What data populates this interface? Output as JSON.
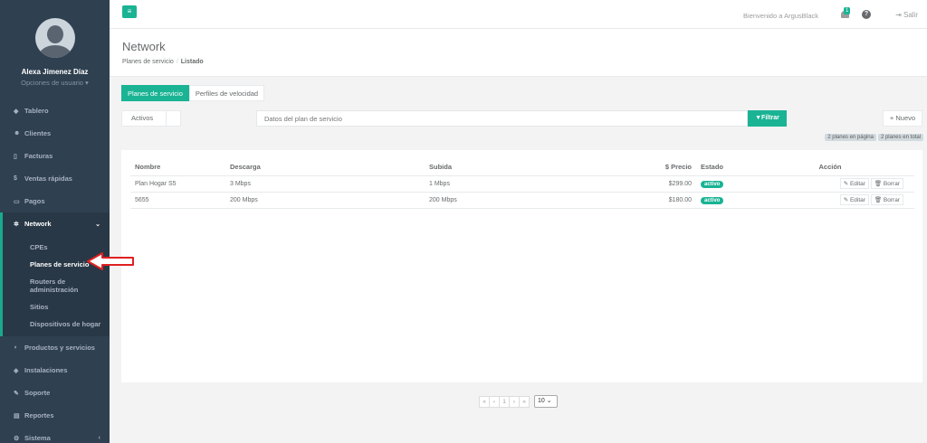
{
  "sidebar": {
    "profile": {
      "name": "Alexa Jimenez Díaz",
      "options": "Opciones de usuario ▾"
    },
    "items": [
      {
        "icon": "dashboard-icon",
        "glyph": "◆",
        "label": "Tablero"
      },
      {
        "icon": "users-icon",
        "glyph": "☻",
        "label": "Clientes"
      },
      {
        "icon": "document-icon",
        "glyph": "▯",
        "label": "Facturas"
      },
      {
        "icon": "dollar-icon",
        "glyph": "$",
        "label": "Ventas rápidas"
      },
      {
        "icon": "card-icon",
        "glyph": "▭",
        "label": "Pagos"
      },
      {
        "icon": "cog-icon",
        "glyph": "✲",
        "label": "Network",
        "chevron": "⌄"
      },
      {
        "icon": "tag-icon",
        "glyph": "◗",
        "label": "Productos y servicios"
      },
      {
        "icon": "wrench-icon",
        "glyph": "◈",
        "label": "Instalaciones"
      },
      {
        "icon": "support-icon",
        "glyph": "✎",
        "label": "Soporte"
      },
      {
        "icon": "book-icon",
        "glyph": "▤",
        "label": "Reportes"
      },
      {
        "icon": "gears-icon",
        "glyph": "⚙",
        "label": "Sistema",
        "chevron": "‹"
      }
    ],
    "network_sub": [
      "CPEs",
      "Planes de servicio",
      "Routers de administración",
      "Sitios",
      "Dispositivos de hogar"
    ]
  },
  "topbar": {
    "menu_glyph": "≡",
    "welcome": "Bienvenido a ArgusBlack",
    "notif_count": "1",
    "help_glyph": "?",
    "logout": "⇥ Salir"
  },
  "heading": {
    "title": "Network",
    "crumb1": "Planes de servicio",
    "crumb_sep": "/",
    "crumb2": "Listado"
  },
  "tabs": [
    "Planes de servicio",
    "Perfiles de velocidad"
  ],
  "filter": {
    "status": "Activos",
    "placeholder": "Datos del plan de servicio",
    "filter_btn": "▼Filtrar",
    "new_btn": "+ Nuevo",
    "page_count": "2 planes en página",
    "total_count": "2 planes en total"
  },
  "table": {
    "headers": [
      "Nombre",
      "Descarga",
      "Subida",
      "$ Precio",
      "Estado",
      "Acción"
    ],
    "rows": [
      {
        "name": "Plan Hogar S5",
        "down": "3 Mbps",
        "up": "1 Mbps",
        "price": "$299.00",
        "status": "activo"
      },
      {
        "name": "5655",
        "down": "200 Mbps",
        "up": "200 Mbps",
        "price": "$180.00",
        "status": "activo"
      }
    ],
    "edit_label": "✎ Editar",
    "delete_label": "🗑 Borrar"
  },
  "pager": {
    "first": "«",
    "prev": "‹",
    "page": "1",
    "next": "›",
    "last": "»",
    "page_size": "10 ⌄"
  },
  "colors": {
    "sidebar": "#2f4050",
    "accent": "#1ab394",
    "annotation": "#e02020"
  }
}
